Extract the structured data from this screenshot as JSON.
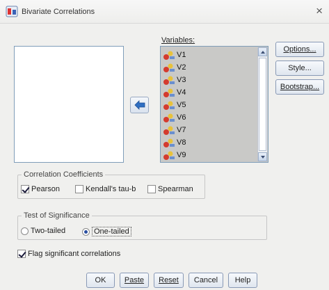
{
  "window": {
    "title": "Bivariate Correlations",
    "close_glyph": "×"
  },
  "variables": {
    "caption": "Variables:",
    "items": [
      "V1",
      "V2",
      "V3",
      "V4",
      "V5",
      "V6",
      "V7",
      "V8",
      "V9"
    ]
  },
  "side_buttons": {
    "options": "Options...",
    "style": "Style...",
    "bootstrap": "Bootstrap..."
  },
  "coefficients": {
    "title": "Correlation Coefficients",
    "pearson": {
      "label": "Pearson",
      "checked": true
    },
    "kendall": {
      "label": "Kendall's tau-b",
      "checked": false
    },
    "spearman": {
      "label": "Spearman",
      "checked": false
    }
  },
  "significance": {
    "title": "Test of Significance",
    "two_tailed": {
      "label": "Two-tailed",
      "selected": false
    },
    "one_tailed": {
      "label": "One-tailed",
      "selected": true
    }
  },
  "flag": {
    "label": "Flag significant correlations",
    "checked": true
  },
  "buttons": {
    "ok": "OK",
    "paste": "Paste",
    "reset": "Reset",
    "cancel": "Cancel",
    "help": "Help"
  },
  "icons": {
    "title_icon": "correlation-dialog-icon",
    "move_arrow": "arrow-left-icon",
    "variable_icon": "scale-variable-icon"
  }
}
